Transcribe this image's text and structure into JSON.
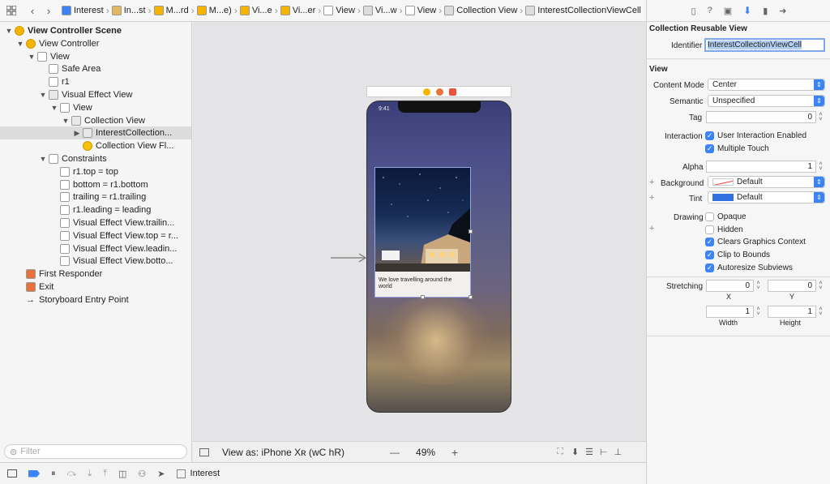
{
  "breadcrumbs": [
    "Interest",
    "In...st",
    "M...rd",
    "M...e)",
    "Vi...e",
    "Vi...er",
    "View",
    "Vi...w",
    "View",
    "Collection View",
    "InterestCollectionViewCell"
  ],
  "navigator": {
    "items": [
      {
        "label": "View Controller Scene",
        "depth": 0,
        "disc": "▼",
        "icon": "scene-icon",
        "color": "#f4b400",
        "bold": true
      },
      {
        "label": "View Controller",
        "depth": 1,
        "disc": "▼",
        "icon": "view-controller-icon",
        "color": "#f4b400"
      },
      {
        "label": "View",
        "depth": 2,
        "disc": "▼",
        "icon": "view-icon",
        "color": "#ffffff"
      },
      {
        "label": "Safe Area",
        "depth": 3,
        "disc": "",
        "icon": "safe-area-icon",
        "color": "#ffffff"
      },
      {
        "label": "r1",
        "depth": 3,
        "disc": "",
        "icon": "image-view-icon",
        "color": "#ffffff"
      },
      {
        "label": "Visual Effect View",
        "depth": 3,
        "disc": "▼",
        "icon": "visual-effect-icon",
        "color": "#e8e8e8"
      },
      {
        "label": "View",
        "depth": 4,
        "disc": "▼",
        "icon": "view-icon",
        "color": "#ffffff"
      },
      {
        "label": "Collection View",
        "depth": 5,
        "disc": "▼",
        "icon": "collection-view-icon",
        "color": "#e8e8e8"
      },
      {
        "label": "InterestCollection...",
        "depth": 6,
        "disc": "▶",
        "icon": "cell-icon",
        "color": "#e8e8e8",
        "selected": true
      },
      {
        "label": "Collection View Fl...",
        "depth": 6,
        "disc": "",
        "icon": "flow-layout-icon",
        "color": "#f4c20d"
      },
      {
        "label": "Constraints",
        "depth": 3,
        "disc": "▼",
        "icon": "constraints-icon",
        "color": "#ffffff"
      },
      {
        "label": "r1.top = top",
        "depth": 4,
        "disc": "",
        "icon": "constraint-icon",
        "color": "#ffffff"
      },
      {
        "label": "bottom = r1.bottom",
        "depth": 4,
        "disc": "",
        "icon": "constraint-icon",
        "color": "#ffffff"
      },
      {
        "label": "trailing = r1.trailing",
        "depth": 4,
        "disc": "",
        "icon": "constraint-icon",
        "color": "#ffffff"
      },
      {
        "label": "r1.leading = leading",
        "depth": 4,
        "disc": "",
        "icon": "constraint-icon",
        "color": "#ffffff"
      },
      {
        "label": "Visual Effect View.trailin...",
        "depth": 4,
        "disc": "",
        "icon": "constraint-icon",
        "color": "#ffffff"
      },
      {
        "label": "Visual Effect View.top = r...",
        "depth": 4,
        "disc": "",
        "icon": "constraint-icon",
        "color": "#ffffff"
      },
      {
        "label": "Visual Effect View.leadin...",
        "depth": 4,
        "disc": "",
        "icon": "constraint-icon",
        "color": "#ffffff"
      },
      {
        "label": "Visual Effect View.botto...",
        "depth": 4,
        "disc": "",
        "icon": "constraint-icon",
        "color": "#ffffff"
      },
      {
        "label": "First Responder",
        "depth": 1,
        "disc": "",
        "icon": "first-responder-icon",
        "color": "#e8733a"
      },
      {
        "label": "Exit",
        "depth": 1,
        "disc": "",
        "icon": "exit-icon",
        "color": "#e8733a"
      },
      {
        "label": "Storyboard Entry Point",
        "depth": 1,
        "disc": "",
        "icon": "entry-point-icon",
        "color": "#ffffff"
      }
    ],
    "filter_placeholder": "Filter"
  },
  "canvas": {
    "status_time": "9:41",
    "cell_caption": "We love travelling around the world",
    "view_as": "View as: iPhone Xʀ (wC hR)",
    "zoom": "49%",
    "zoom_out": "—",
    "zoom_in": "+"
  },
  "bottom_bar": {
    "scheme": "Interest"
  },
  "inspector": {
    "section_title": "Collection Reusable View",
    "identifier_label": "Identifier",
    "identifier_value": "InterestCollectionViewCell",
    "view_header": "View",
    "content_mode_label": "Content Mode",
    "content_mode_value": "Center",
    "semantic_label": "Semantic",
    "semantic_value": "Unspecified",
    "tag_label": "Tag",
    "tag_value": "0",
    "interaction_label": "Interaction",
    "user_interaction": "User Interaction Enabled",
    "multiple_touch": "Multiple Touch",
    "alpha_label": "Alpha",
    "alpha_value": "1",
    "background_label": "Background",
    "background_value": "Default",
    "tint_label": "Tint",
    "tint_value": "Default",
    "drawing_label": "Drawing",
    "opaque": "Opaque",
    "hidden": "Hidden",
    "clears_graphics": "Clears Graphics Context",
    "clip_to_bounds": "Clip to Bounds",
    "autoresize": "Autoresize Subviews",
    "stretching_label": "Stretching",
    "stretch_x_value": "0",
    "stretch_y_value": "0",
    "x_label": "X",
    "y_label": "Y",
    "width_value": "1",
    "height_value": "1",
    "width_label": "Width",
    "height_label": "Height",
    "plus": "+"
  },
  "colors": {
    "accent": "#3a84f6",
    "tint_swatch": "#2f6fe0",
    "selection": "#dcdcdc"
  }
}
